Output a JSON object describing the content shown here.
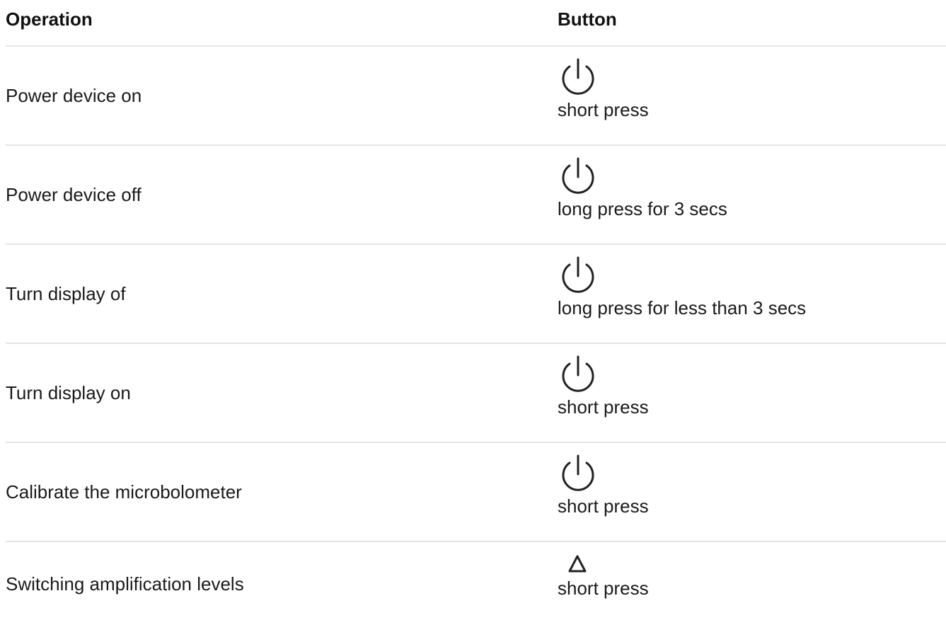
{
  "table": {
    "headers": {
      "operation": "Operation",
      "button": "Button"
    },
    "rows": [
      {
        "operation": "Power device on",
        "button_icon": "power-icon",
        "button_text": "short press"
      },
      {
        "operation": "Power device off",
        "button_icon": "power-icon",
        "button_text": "long press for 3 secs"
      },
      {
        "operation": "Turn display of",
        "button_icon": "power-icon",
        "button_text": "long press for less than 3 secs"
      },
      {
        "operation": "Turn display on",
        "button_icon": "power-icon",
        "button_text": "short press"
      },
      {
        "operation": "Calibrate the microbolometer",
        "button_icon": "power-icon",
        "button_text": "short press"
      },
      {
        "operation": "Switching amplification levels",
        "button_icon": "triangle-up-icon",
        "button_text": "short press"
      }
    ]
  },
  "colors": {
    "text": "#1a1a1a",
    "divider": "#e4e4e4",
    "icon_stroke": "#222222"
  }
}
